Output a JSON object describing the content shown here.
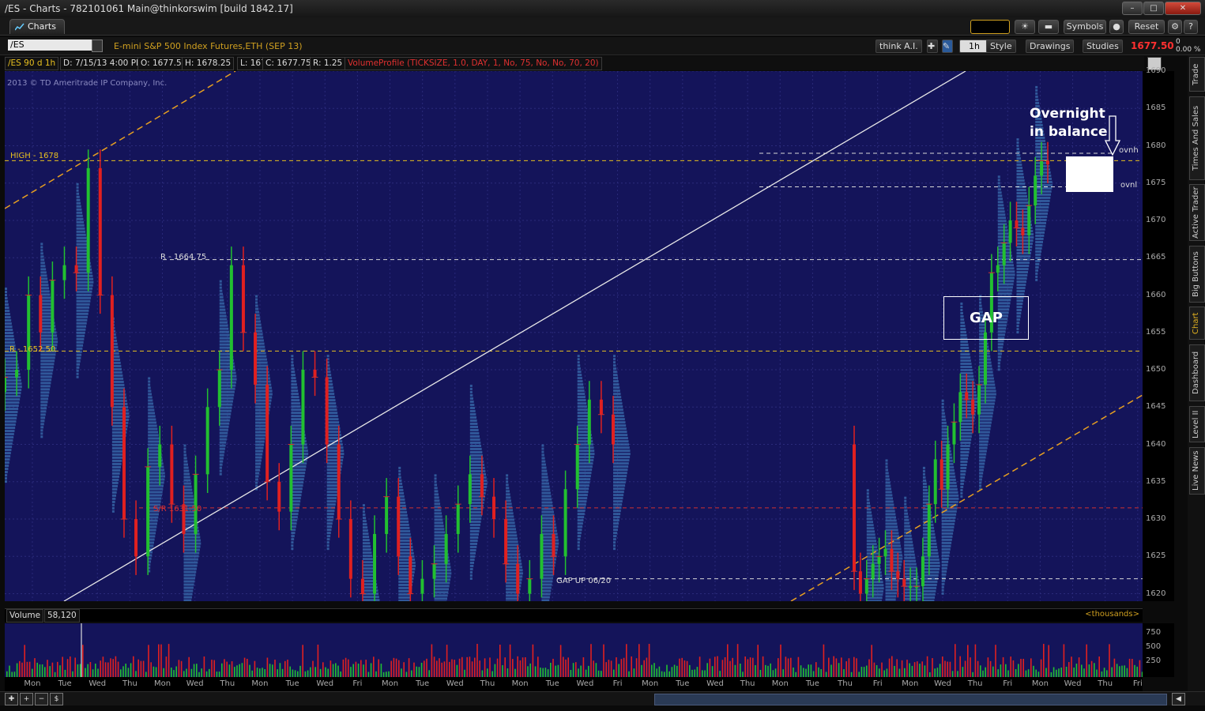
{
  "window": {
    "title": "/ES - Charts - 782101061 Main@thinkorswim [build 1842.17]",
    "tab_label": "Charts",
    "buttons": {
      "symbols": "Symbols",
      "reset": "Reset"
    }
  },
  "symbol_bar": {
    "symbol": "/ES",
    "description": "E-mini S&P 500 Index Futures,ETH (SEP 13)",
    "think_ai": "think A.I.",
    "timeframe": "1h",
    "style": "Style",
    "drawings": "Drawings",
    "studies": "Studies",
    "last_price": "1677.50",
    "change": "0",
    "change_pct": "0.00 %"
  },
  "info_bar": {
    "aggregation": "/ES 90 d 1h",
    "date": "D: 7/15/13 4:00 PM",
    "open": "O: 1677.5",
    "high": "H: 1678.25",
    "low": "L: 1677",
    "close": "C: 1677.75",
    "range": "R: 1.25",
    "study": "VolumeProfile (TICKSIZE, 1.0, DAY, 1, No, 75, No, No, 70, 20)"
  },
  "chart": {
    "copyright": "2013 © TD Ameritrade IP Company, Inc.",
    "annotations": {
      "high": "HIGH - 1678",
      "r1": "R - 1664.75",
      "r2": "R - 1652.50",
      "sr": "S/R 1631.50",
      "gap_up": "GAP UP 06/20",
      "ovnh": "ovnh",
      "ovnl": "ovnl",
      "gap": "GAP",
      "overnight_line1": "Overnight",
      "overnight_line2": "in balance"
    },
    "price_ticks": [
      "1690",
      "1685",
      "1680",
      "1675",
      "1670",
      "1665",
      "1660",
      "1655",
      "1650",
      "1645",
      "1640",
      "1635",
      "1630",
      "1625",
      "1620"
    ]
  },
  "chart_data": {
    "type": "candlestick",
    "ylim": [
      1619,
      1690
    ],
    "levels": [
      {
        "label": "HIGH - 1678",
        "price": 1678,
        "color": "#e8c020"
      },
      {
        "label": "R - 1664.75",
        "price": 1664.75,
        "color": "#d8d8d8"
      },
      {
        "label": "R - 1652.50",
        "price": 1652.5,
        "color": "#e8c020"
      },
      {
        "label": "S/R 1631.50",
        "price": 1631.5,
        "color": "#d03030"
      },
      {
        "label": "GAP UP 06/20",
        "price": 1622,
        "color": "#d8d8d8"
      },
      {
        "label": "ovnh",
        "price": 1679,
        "color": "#d8d8d8"
      },
      {
        "label": "ovnl",
        "price": 1674.5,
        "color": "#d8d8d8"
      }
    ],
    "close_series": [
      1649,
      1650,
      1660,
      1655,
      1662,
      1664,
      1663,
      1677,
      1660,
      1645,
      1630,
      1625,
      1637,
      1640,
      1632,
      1628,
      1636,
      1645,
      1650,
      1664,
      1655,
      1648,
      1635,
      1631,
      1640,
      1650,
      1649,
      1640,
      1630,
      1622,
      1620,
      1628,
      1633,
      1625,
      1620,
      1622,
      1624,
      1628,
      1632,
      1636,
      1633,
      1630,
      1624,
      1620,
      1622,
      1628,
      1625,
      1634,
      1640,
      1646,
      1644,
      1640,
      1623,
      1620,
      1622,
      1624,
      1625,
      1626,
      1623,
      1622,
      1621,
      1621,
      1621,
      1625,
      1632,
      1638,
      1634,
      1640,
      1643,
      1647,
      1646,
      1644,
      1648,
      1655,
      1663,
      1664,
      1667,
      1670,
      1669,
      1668,
      1672,
      1676,
      1678,
      1677.5
    ]
  },
  "volume": {
    "label": "Volume",
    "value": "58,120",
    "unit": "<thousands>",
    "ticks": [
      "750",
      "500",
      "250"
    ]
  },
  "days": [
    "Mon",
    "Tue",
    "Wed",
    "Thu",
    "Mon",
    "Wed",
    "Thu",
    "Mon",
    "Tue",
    "Wed",
    "Fri",
    "Mon",
    "Tue",
    "Wed",
    "Thu",
    "Mon",
    "Tue",
    "Wed",
    "Fri",
    "Mon",
    "Tue",
    "Wed",
    "Thu",
    "Mon",
    "Tue",
    "Thu",
    "Fri",
    "Mon",
    "Wed",
    "Thu",
    "Fri",
    "Mon",
    "Wed",
    "Thu",
    "Fri"
  ],
  "sidebar": [
    "Trade",
    "Times And Sales",
    "Active Trader",
    "Big Buttons",
    "Chart",
    "Dashboard",
    "Level II",
    "Live News"
  ],
  "colors": {
    "bg": "#14145a",
    "up": "#22c030",
    "down": "#e02020",
    "profile": "#3a6fb0",
    "trend_orange": "#e8a020"
  }
}
